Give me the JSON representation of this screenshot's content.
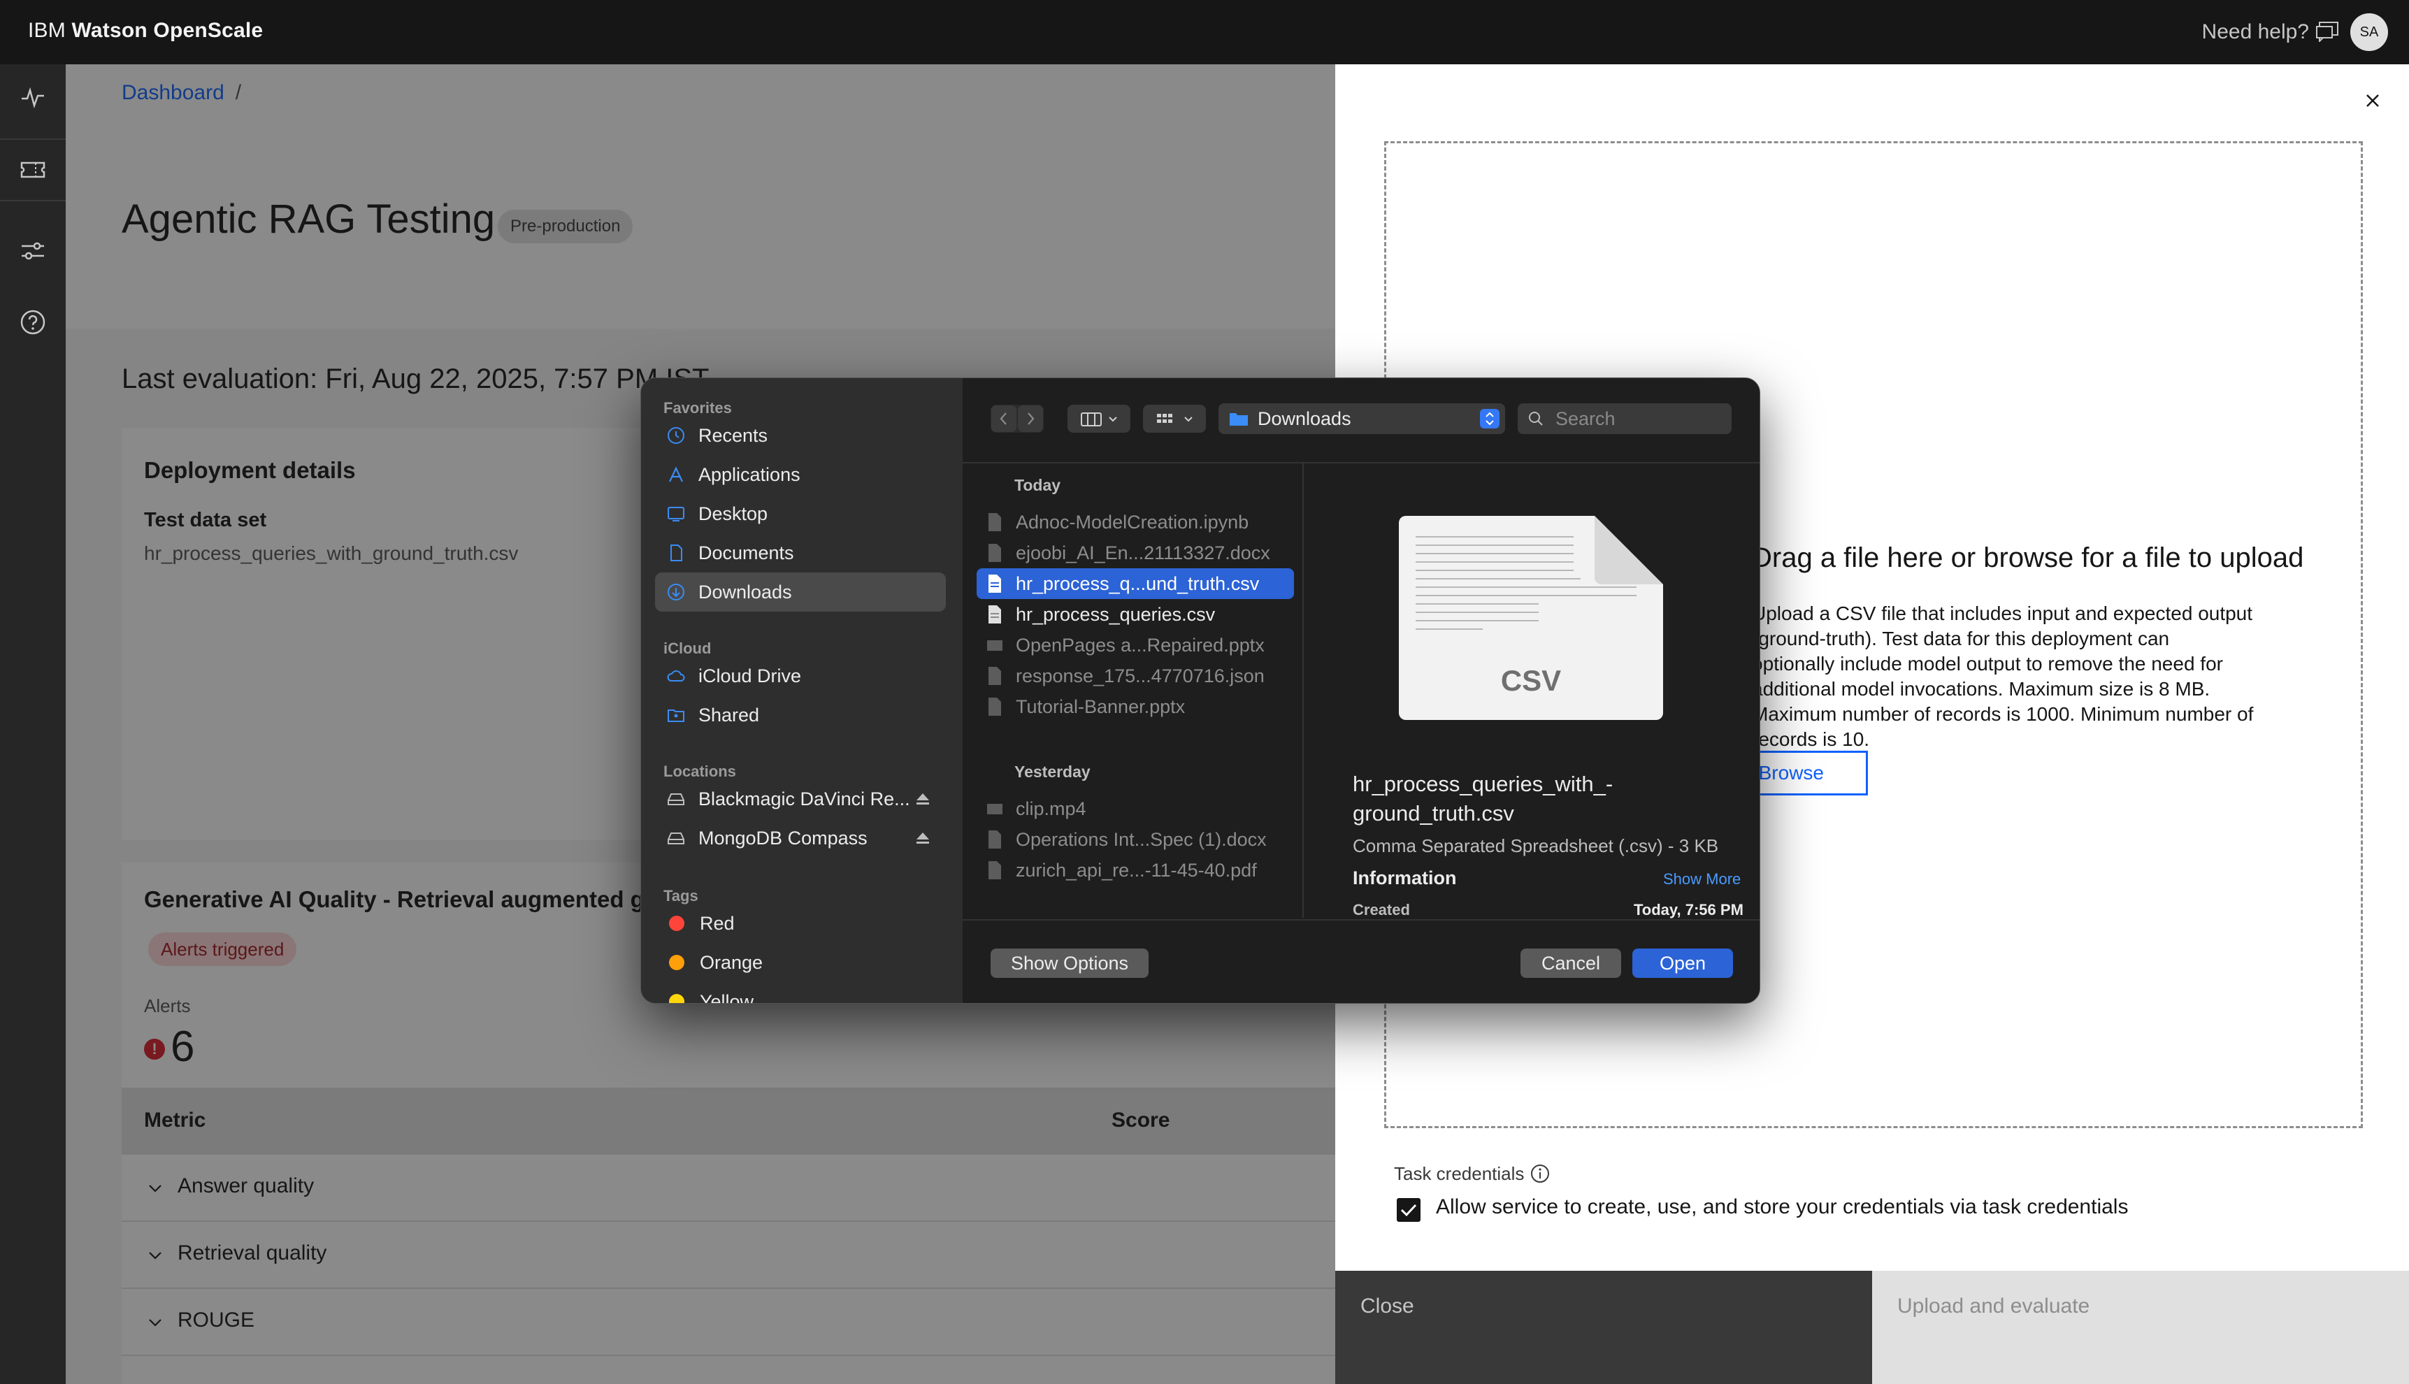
{
  "topbar": {
    "brand_prefix": "IBM ",
    "brand_name": "Watson OpenScale",
    "help": "Need help?",
    "avatar": "SA"
  },
  "rail": {
    "icons": [
      "activity-icon",
      "ticket-icon",
      "sliders-icon",
      "help-circle-icon"
    ]
  },
  "page": {
    "breadcrumb": "Dashboard",
    "breadcrumb_sep": "/",
    "title": "Agentic RAG Testing",
    "env_tag": "Pre-production",
    "last_evaluation": "Last evaluation: Fri, Aug 22, 2025, 7:57 PM IST",
    "deployment": {
      "title": "Deployment details",
      "test_data_label": "Test data set",
      "test_data_value": "hr_process_queries_with_ground_truth.csv"
    },
    "genai": {
      "title": "Generative AI Quality - Retrieval augmented generation",
      "alerts_tag": "Alerts triggered",
      "alerts_label": "Alerts",
      "alerts_icon": "!",
      "alerts_count": "6"
    },
    "metrics_table": {
      "col_metric": "Metric",
      "col_score": "Score",
      "rows": [
        "Answer quality",
        "Retrieval quality",
        "ROUGE"
      ]
    }
  },
  "panel": {
    "dropzone_title": "Drag a file here or browse for a file to upload",
    "dropzone_desc": "Upload a CSV file that includes input and expected output (ground-truth). Test data for this deployment can optionally include model output to remove the need for additional model invocations. Maximum size is 8 MB. Maximum number of records is 1000. Minimum number of records is 10.",
    "browse_label": "Browse",
    "task_credentials_label": "Task credentials",
    "credentials_checkbox_text": "Allow service to create, use, and store your credentials via task credentials",
    "credentials_checked": true,
    "close_button": "Close",
    "upload_button": "Upload and evaluate"
  },
  "file_dialog": {
    "sidebar": {
      "favorites_title": "Favorites",
      "favorites": [
        {
          "label": "Recents",
          "icon": "clock-icon"
        },
        {
          "label": "Applications",
          "icon": "applications-icon"
        },
        {
          "label": "Desktop",
          "icon": "desktop-icon"
        },
        {
          "label": "Documents",
          "icon": "document-icon"
        },
        {
          "label": "Downloads",
          "icon": "download-icon",
          "selected": true
        }
      ],
      "icloud_title": "iCloud",
      "icloud": [
        {
          "label": "iCloud Drive",
          "icon": "cloud-icon"
        },
        {
          "label": "Shared",
          "icon": "shared-folder-icon"
        }
      ],
      "locations_title": "Locations",
      "locations": [
        {
          "label": "Blackmagic DaVinci Re...",
          "icon": "drive-icon"
        },
        {
          "label": "MongoDB Compass",
          "icon": "drive-icon"
        }
      ],
      "tags_title": "Tags",
      "tags": [
        {
          "label": "Red",
          "color": "#ff453a"
        },
        {
          "label": "Orange",
          "color": "#ff9f0a"
        },
        {
          "label": "Yellow",
          "color": "#ffd60a"
        }
      ]
    },
    "location": "Downloads",
    "search_placeholder": "Search",
    "today_label": "Today",
    "today_files": [
      {
        "name": "Adnoc-ModelCreation.ipynb",
        "active": false
      },
      {
        "name": "ejoobi_AI_En...21113327.docx",
        "active": false
      },
      {
        "name": "hr_process_q...und_truth.csv",
        "active": true,
        "selected": true
      },
      {
        "name": "hr_process_queries.csv",
        "active": true
      },
      {
        "name": "OpenPages a...Repaired.pptx",
        "active": false
      },
      {
        "name": "response_175...4770716.json",
        "active": false
      },
      {
        "name": "Tutorial-Banner.pptx",
        "active": false
      }
    ],
    "yesterday_label": "Yesterday",
    "yesterday_files": [
      {
        "name": "clip.mp4",
        "active": false
      },
      {
        "name": "Operations Int...Spec (1).docx",
        "active": false
      },
      {
        "name": "zurich_api_re...-11-45-40.pdf",
        "active": false
      }
    ],
    "preview": {
      "doc_label": "CSV",
      "name_line1": "hr_process_queries_with_-",
      "name_line2": "ground_truth.csv",
      "kind": "Comma Separated Spreadsheet (.csv) - 3 KB",
      "info": "Information",
      "show_more": "Show More",
      "created_label": "Created",
      "created_value": "Today, 7:56 PM"
    },
    "show_options": "Show Options",
    "cancel": "Cancel",
    "open": "Open"
  }
}
